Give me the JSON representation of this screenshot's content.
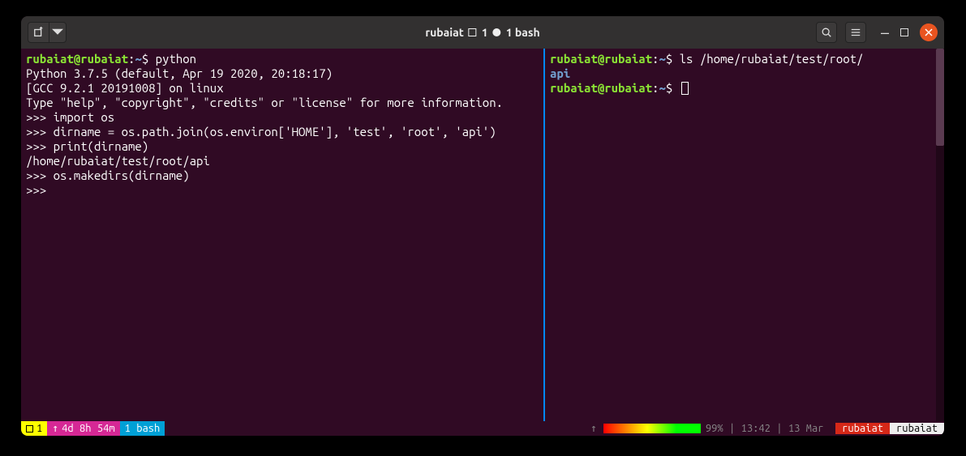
{
  "title": {
    "name": "rubaiat",
    "badge1": "1",
    "badge2": "1 bash"
  },
  "left_pane": {
    "prompt": {
      "user": "rubaiat",
      "host": "rubaiat",
      "path": "~",
      "cmd": "python"
    },
    "lines": [
      "Python 3.7.5 (default, Apr 19 2020, 20:18:17)",
      "[GCC 9.2.1 20191008] on linux",
      "Type \"help\", \"copyright\", \"credits\" or \"license\" for more information.",
      ">>> import os",
      ">>> dirname = os.path.join(os.environ['HOME'], 'test', 'root', 'api')",
      ">>> print(dirname)",
      "/home/rubaiat/test/root/api",
      ">>> os.makedirs(dirname)",
      ">>> "
    ]
  },
  "right_pane": {
    "prompt1": {
      "user": "rubaiat",
      "host": "rubaiat",
      "path": "~",
      "cmd": "ls /home/rubaiat/test/root/"
    },
    "output_dir": "api",
    "prompt2": {
      "user": "rubaiat",
      "host": "rubaiat",
      "path": "~"
    }
  },
  "statusbar": {
    "session": "1",
    "uptime": "4d 8h 54m",
    "window": "1 bash",
    "cpu_pct": "99%",
    "time": "13:42",
    "date": "13 Mar",
    "user1": "rubaiat",
    "user2": "rubaiat"
  }
}
